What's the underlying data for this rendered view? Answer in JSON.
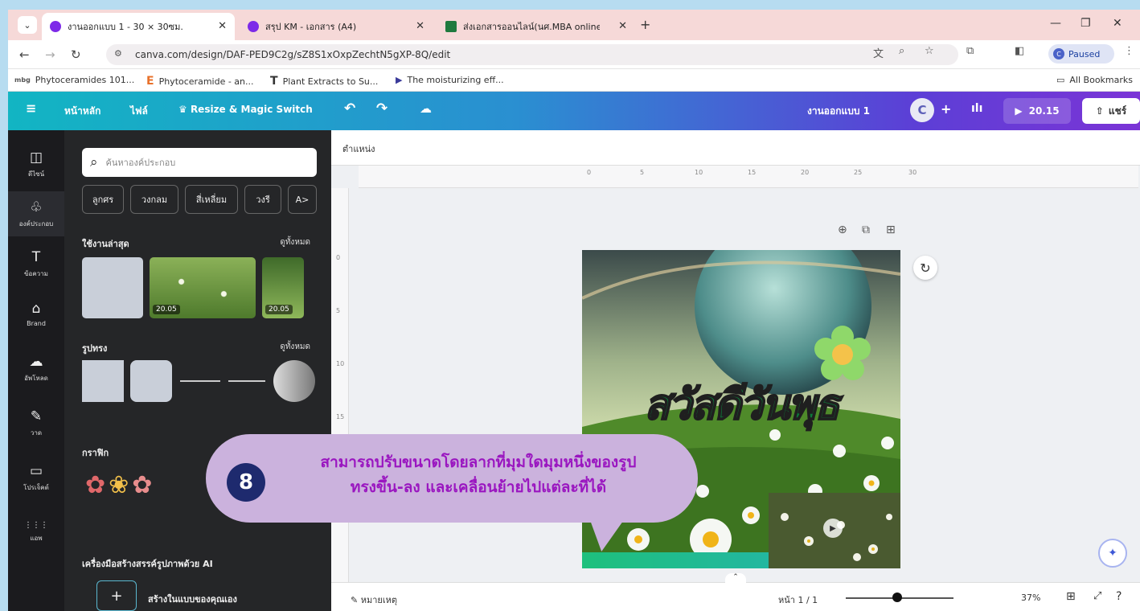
{
  "browser": {
    "tabs": [
      {
        "label": "งานออกแบบ 1 - 30 × 30ซม.",
        "active": true
      },
      {
        "label": "สรุป KM - เอกสาร (A4)",
        "active": false
      },
      {
        "label": "ส่งเอกสารออนไลน์(นศ.MBA online",
        "active": false
      }
    ],
    "new_tab": "+",
    "url": "canva.com/design/DAF-PED9C2g/sZ8S1xOxpZechtN5gXP-8Q/edit",
    "profile_status": "Paused",
    "profile_initial": "C",
    "bookmarks": [
      {
        "icon": "mbg",
        "label": "Phytoceramides 101..."
      },
      {
        "icon": "E",
        "label": "Phytoceramide - an..."
      },
      {
        "icon": "T",
        "label": "Plant Extracts to Su..."
      },
      {
        "icon": "▶",
        "label": "The moisturizing eff..."
      }
    ],
    "all_bookmarks": "All Bookmarks"
  },
  "canva_header": {
    "home": "หน้าหลัก",
    "file": "ไฟล์",
    "resize": "Resize & Magic Switch",
    "design_name": "งานออกแบบ 1",
    "avatar_initial": "C",
    "present_time": "20.15",
    "share": "แชร์"
  },
  "rail": [
    {
      "icon": "◫",
      "label": "ดีไซน์"
    },
    {
      "icon": "♧",
      "label": "องค์ประกอบ",
      "selected": true
    },
    {
      "icon": "T",
      "label": "ข้อความ"
    },
    {
      "icon": "⌂",
      "label": "Brand"
    },
    {
      "icon": "☁",
      "label": "อัพโหลด"
    },
    {
      "icon": "✎",
      "label": "วาด"
    },
    {
      "icon": "▭",
      "label": "โปรเจ็คต์"
    },
    {
      "icon": "⋮⋮⋮",
      "label": "แอพ"
    }
  ],
  "panel": {
    "search_placeholder": "ค้นหาองค์ประกอบ",
    "chips": [
      "ลูกศร",
      "วงกลม",
      "สี่เหลี่ยม",
      "วงรี",
      "A>"
    ],
    "recent_title": "ใช้งานล่าสุด",
    "see_all": "ดูทั้งหมด",
    "recent_badges": [
      "20.05",
      "20.05"
    ],
    "shapes_title": "รูปทรง",
    "graphics_title": "กราฟิก",
    "ai_title": "เครื่องมือสร้างสรรค์รูปภาพด้วย AI",
    "ai_create": "สร้างในแบบของคุณเอง"
  },
  "workspace": {
    "page_title": "ตำแหน่ง",
    "ruler_ticks": [
      "0",
      "5",
      "10",
      "15",
      "20",
      "25",
      "30"
    ],
    "vruler_ticks": [
      "0",
      "5",
      "10",
      "15",
      "20"
    ],
    "artwork_text": "สวัสดีวันพุธ",
    "notes": "หมายเหตุ",
    "page_indicator": "หน้า 1 / 1",
    "zoom": "37%"
  },
  "callout": {
    "number": "8",
    "text_line1": "สามารถปรับขนาดโดยลากที่มุมใดมุมหนึ่งของรูป",
    "text_line2": "ทรงขึ้น-ลง และเคลื่อนย้ายไปแต่ละที่ได้"
  }
}
